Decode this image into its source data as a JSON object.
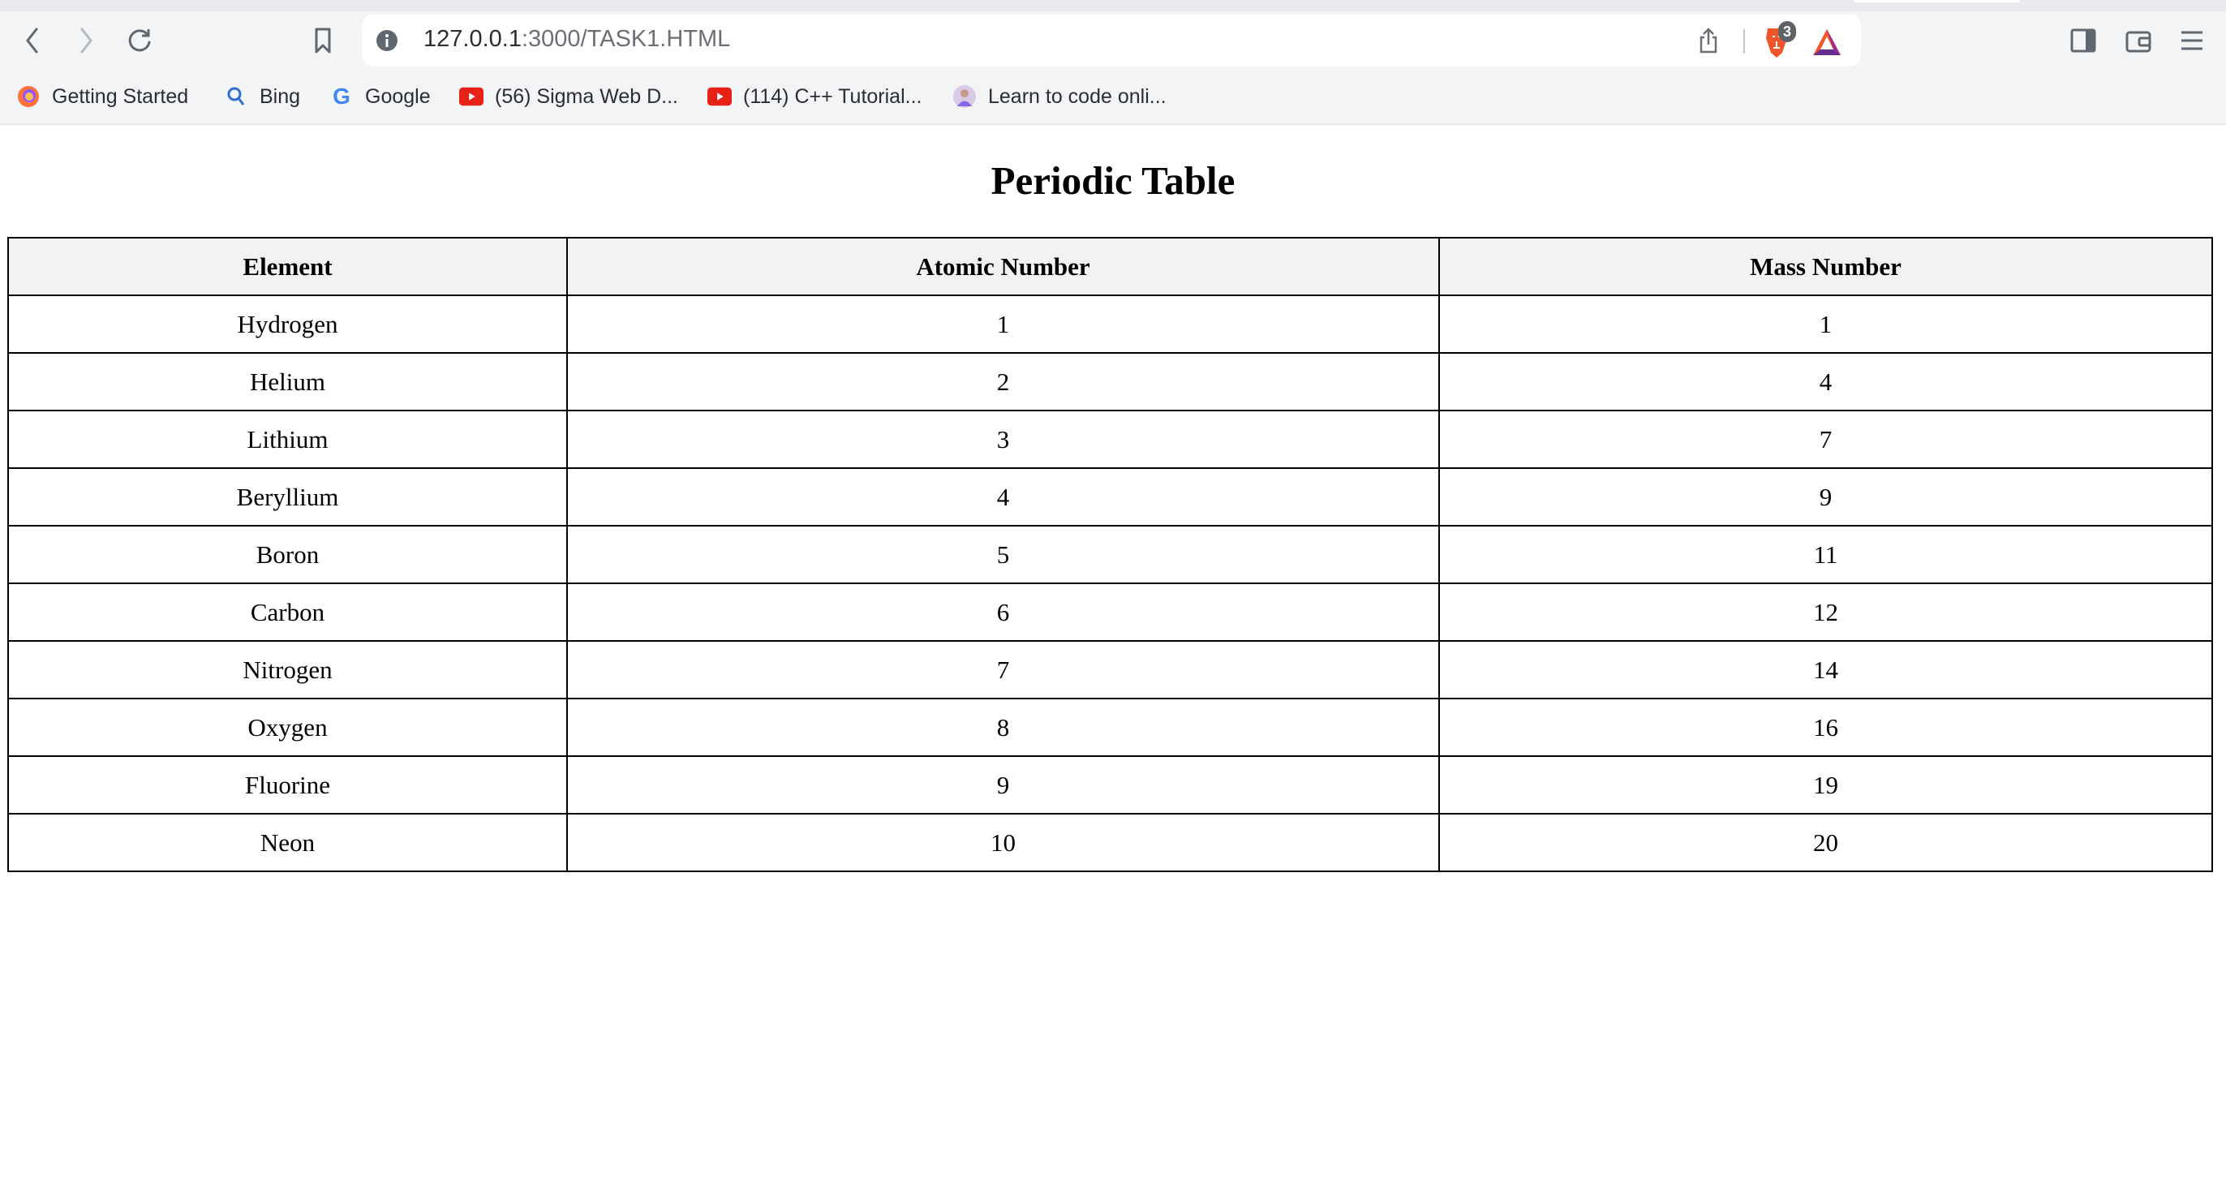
{
  "browser": {
    "url_host": "127.0.0.1",
    "url_rest": ":3000/TASK1.HTML",
    "shields_badge": "3",
    "bookmarks": [
      {
        "label": "Getting Started",
        "icon": "firefox-icon"
      },
      {
        "label": "Bing",
        "icon": "bing-search-icon"
      },
      {
        "label": "Google",
        "icon": "google-icon"
      },
      {
        "label": "(56) Sigma Web D...",
        "icon": "youtube-icon"
      },
      {
        "label": "(114) C++ Tutorial...",
        "icon": "youtube-icon"
      },
      {
        "label": "Learn to code onli...",
        "icon": "avatar-icon"
      }
    ]
  },
  "page": {
    "title": "Periodic Table",
    "columns": [
      "Element",
      "Atomic Number",
      "Mass Number"
    ],
    "rows": [
      [
        "Hydrogen",
        "1",
        "1"
      ],
      [
        "Helium",
        "2",
        "4"
      ],
      [
        "Lithium",
        "3",
        "7"
      ],
      [
        "Beryllium",
        "4",
        "9"
      ],
      [
        "Boron",
        "5",
        "11"
      ],
      [
        "Carbon",
        "6",
        "12"
      ],
      [
        "Nitrogen",
        "7",
        "14"
      ],
      [
        "Oxygen",
        "8",
        "16"
      ],
      [
        "Fluorine",
        "9",
        "19"
      ],
      [
        "Neon",
        "10",
        "20"
      ]
    ]
  }
}
